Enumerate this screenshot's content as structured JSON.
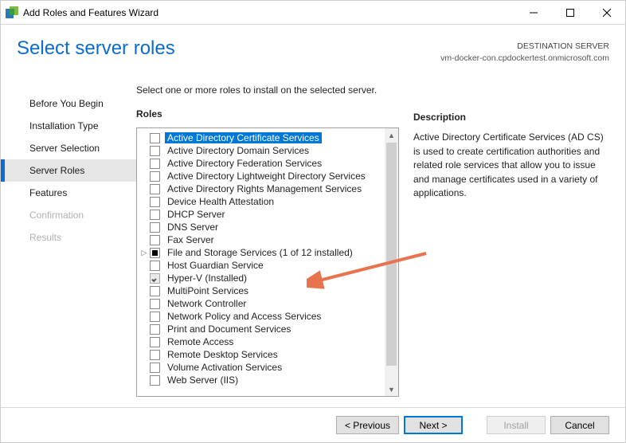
{
  "window": {
    "title": "Add Roles and Features Wizard"
  },
  "header": {
    "title": "Select server roles",
    "destination_label": "DESTINATION SERVER",
    "destination_value": "vm-docker-con.cpdockertest.onmicrosoft.com"
  },
  "sidebar": {
    "items": [
      {
        "label": "Before You Begin",
        "state": "normal"
      },
      {
        "label": "Installation Type",
        "state": "normal"
      },
      {
        "label": "Server Selection",
        "state": "normal"
      },
      {
        "label": "Server Roles",
        "state": "active"
      },
      {
        "label": "Features",
        "state": "normal"
      },
      {
        "label": "Confirmation",
        "state": "faded"
      },
      {
        "label": "Results",
        "state": "faded"
      }
    ]
  },
  "main": {
    "instruction": "Select one or more roles to install on the selected server.",
    "roles_label": "Roles",
    "description_label": "Description",
    "roles": [
      {
        "label": "Active Directory Certificate Services",
        "checked": "unchecked",
        "selected": true
      },
      {
        "label": "Active Directory Domain Services",
        "checked": "unchecked"
      },
      {
        "label": "Active Directory Federation Services",
        "checked": "unchecked"
      },
      {
        "label": "Active Directory Lightweight Directory Services",
        "checked": "unchecked"
      },
      {
        "label": "Active Directory Rights Management Services",
        "checked": "unchecked"
      },
      {
        "label": "Device Health Attestation",
        "checked": "unchecked"
      },
      {
        "label": "DHCP Server",
        "checked": "unchecked"
      },
      {
        "label": "DNS Server",
        "checked": "unchecked"
      },
      {
        "label": "Fax Server",
        "checked": "unchecked"
      },
      {
        "label": "File and Storage Services (1 of 12 installed)",
        "checked": "indeterminate",
        "expandable": true
      },
      {
        "label": "Host Guardian Service",
        "checked": "unchecked"
      },
      {
        "label": "Hyper-V (Installed)",
        "checked": "checked-disabled"
      },
      {
        "label": "MultiPoint Services",
        "checked": "unchecked"
      },
      {
        "label": "Network Controller",
        "checked": "unchecked"
      },
      {
        "label": "Network Policy and Access Services",
        "checked": "unchecked"
      },
      {
        "label": "Print and Document Services",
        "checked": "unchecked"
      },
      {
        "label": "Remote Access",
        "checked": "unchecked"
      },
      {
        "label": "Remote Desktop Services",
        "checked": "unchecked"
      },
      {
        "label": "Volume Activation Services",
        "checked": "unchecked"
      },
      {
        "label": "Web Server (IIS)",
        "checked": "unchecked"
      }
    ],
    "description": "Active Directory Certificate Services (AD CS) is used to create certification authorities and related role services that allow you to issue and manage certificates used in a variety of applications."
  },
  "footer": {
    "previous": "< Previous",
    "next": "Next >",
    "install": "Install",
    "cancel": "Cancel"
  }
}
